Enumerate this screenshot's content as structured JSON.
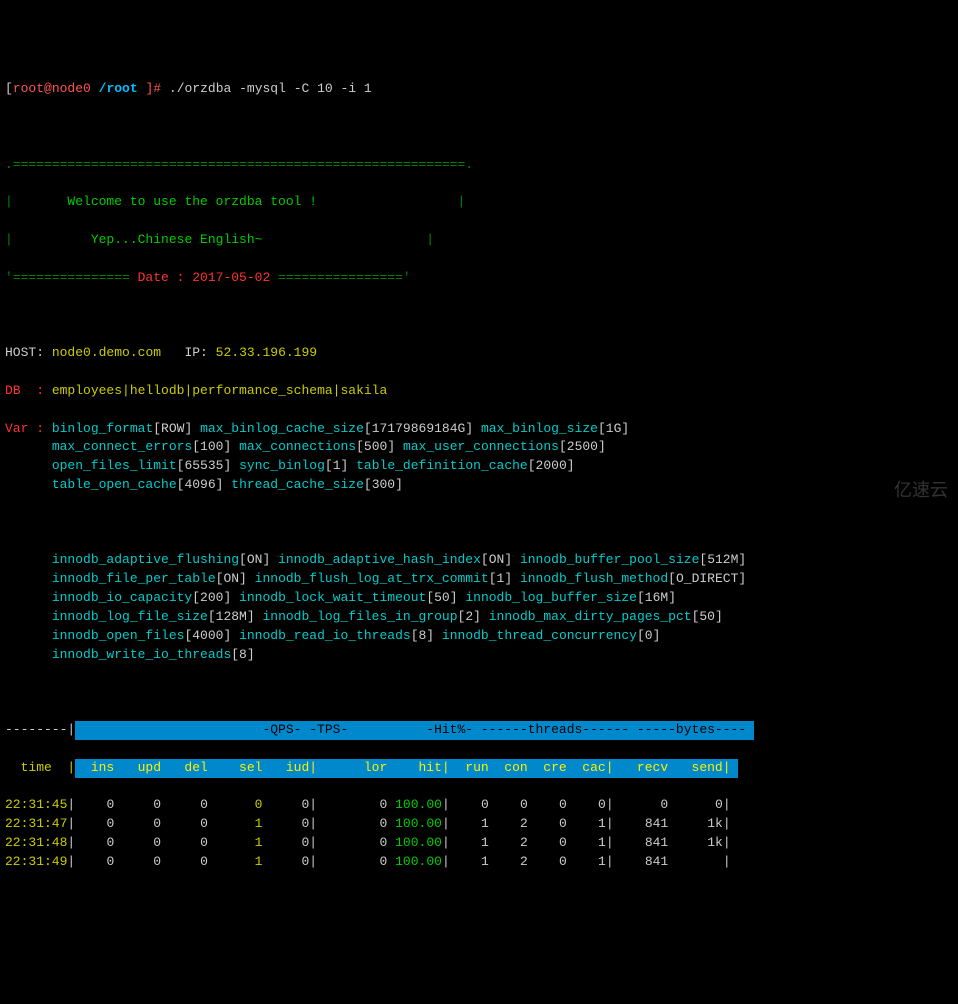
{
  "prompt": {
    "user_host": "root@node0",
    "path": "/root",
    "command": "./orzdba -mysql -C 10 -i 1"
  },
  "banner": {
    "top_border": ".==========================================================.",
    "welcome": "Welcome to use the orzdba tool !",
    "yep": "Yep...Chinese English~",
    "date_eq_left": "'=============== ",
    "date_label": "Date : 2017-05-02",
    "date_eq_right": " ================'"
  },
  "host": {
    "label": "HOST:",
    "name": "node0.demo.com",
    "ip_label": "IP:",
    "ip": "52.33.196.199"
  },
  "db": {
    "label": "DB  :",
    "value": "employees|hellodb|performance_schema|sakila"
  },
  "var_label": "Var :",
  "vars": [
    [
      [
        "binlog_format",
        "[ROW]"
      ],
      [
        "max_binlog_cache_size",
        "[17179869184G]"
      ],
      [
        "max_binlog_size",
        "[1G]"
      ]
    ],
    [
      [
        "max_connect_errors",
        "[100]"
      ],
      [
        "max_connections",
        "[500]"
      ],
      [
        "max_user_connections",
        "[2500]"
      ]
    ],
    [
      [
        "open_files_limit",
        "[65535]"
      ],
      [
        "sync_binlog",
        "[1]"
      ],
      [
        "table_definition_cache",
        "[2000]"
      ]
    ],
    [
      [
        "table_open_cache",
        "[4096]"
      ],
      [
        "thread_cache_size",
        "[300]"
      ]
    ]
  ],
  "innodb_vars": [
    [
      [
        "innodb_adaptive_flushing",
        "[ON]"
      ],
      [
        "innodb_adaptive_hash_index",
        "[ON]"
      ],
      [
        "innodb_buffer_pool_size",
        "[512M]"
      ]
    ],
    [
      [
        "innodb_file_per_table",
        "[ON]"
      ],
      [
        "innodb_flush_log_at_trx_commit",
        "[1]"
      ],
      [
        "innodb_flush_method",
        "[O_DIRECT]"
      ]
    ],
    [
      [
        "innodb_io_capacity",
        "[200]"
      ],
      [
        "innodb_lock_wait_timeout",
        "[50]"
      ],
      [
        "innodb_log_buffer_size",
        "[16M]"
      ]
    ],
    [
      [
        "innodb_log_file_size",
        "[128M]"
      ],
      [
        "innodb_log_files_in_group",
        "[2]"
      ],
      [
        "innodb_max_dirty_pages_pct",
        "[50]"
      ]
    ],
    [
      [
        "innodb_open_files",
        "[4000]"
      ],
      [
        "innodb_read_io_threads",
        "[8]"
      ],
      [
        "innodb_thread_concurrency",
        "[0]"
      ]
    ],
    [
      [
        "innodb_write_io_threads",
        "[8]"
      ]
    ]
  ],
  "table_header1": {
    "dashes": "--------|",
    "content": "                        -QPS- -TPS-          -Hit%- ------threads------ -----bytes---- "
  },
  "table_header2": {
    "time_col": "  time  |",
    "content": "  ins   upd   del    sel   iud|      lor    hit|  run  con  cre  cac|   recv   send| "
  },
  "chart_data": {
    "type": "table",
    "columns": [
      "time",
      "ins",
      "upd",
      "del",
      "sel",
      "iud",
      "lor",
      "hit",
      "run",
      "con",
      "cre",
      "cac",
      "recv",
      "send"
    ],
    "rows": [
      {
        "time": "22:31:45",
        "ins": 0,
        "upd": 0,
        "del": 0,
        "sel": 0,
        "iud": 0,
        "lor": 0,
        "hit": "100.00",
        "run": 0,
        "con": 0,
        "cre": 0,
        "cac": 0,
        "recv": 0,
        "send": 0
      },
      {
        "time": "22:31:47",
        "ins": 0,
        "upd": 0,
        "del": 0,
        "sel": 1,
        "iud": 0,
        "lor": 0,
        "hit": "100.00",
        "run": 1,
        "con": 2,
        "cre": 0,
        "cac": 1,
        "recv": 841,
        "send": "1k"
      },
      {
        "time": "22:31:48",
        "ins": 0,
        "upd": 0,
        "del": 0,
        "sel": 1,
        "iud": 0,
        "lor": 0,
        "hit": "100.00",
        "run": 1,
        "con": 2,
        "cre": 0,
        "cac": 1,
        "recv": 841,
        "send": "1k"
      },
      {
        "time": "22:31:49",
        "ins": 0,
        "upd": 0,
        "del": 0,
        "sel": 1,
        "iud": 0,
        "lor": 0,
        "hit": "100.00",
        "run": 1,
        "con": 2,
        "cre": 0,
        "cac": 1,
        "recv": 841,
        "send": ""
      }
    ]
  },
  "watermark": "亿速云"
}
